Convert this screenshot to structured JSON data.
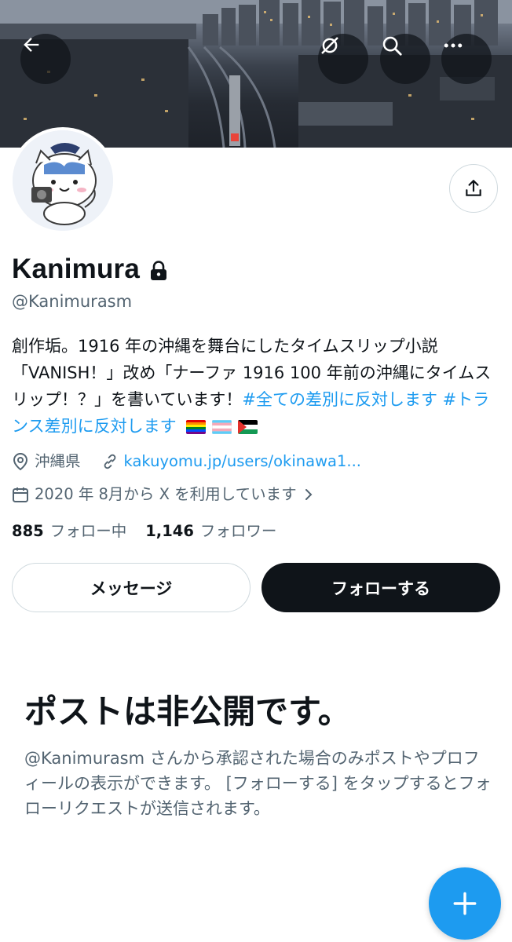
{
  "profile": {
    "display_name": "Kanimura",
    "handle": "@Kanimurasm",
    "bio_text": "創作垢。1916 年の沖縄を舞台にしたタイムスリップ小説「VANISH！」改め「ナーファ 1916 100 年前の沖縄にタイムスリップ！？」を書いています！",
    "bio_tag_1": "#全ての差別に反対します",
    "bio_tag_2": "#トランス差別に反対します",
    "location": "沖縄県",
    "website": "kakuyomu.jp/users/okinawa1...",
    "joined": "2020 年 8月から X を利用しています",
    "following_count": "885",
    "following_label": "フォロー中",
    "followers_count": "1,146",
    "followers_label": "フォロワー"
  },
  "actions": {
    "message_label": "メッセージ",
    "follow_label": "フォローする"
  },
  "private_notice": {
    "title": "ポストは非公開です。",
    "description": "@Kanimurasm さんから承認された場合のみポストやプロフィールの表示ができます。 [フォローする] をタップするとフォローリクエストが送信されます。"
  },
  "icons": {
    "back": "arrow-left-icon",
    "hide": "eye-slash-icon",
    "search": "search-icon",
    "more": "ellipsis-icon",
    "share": "share-icon",
    "lock": "lock-icon",
    "location": "location-pin-icon",
    "link": "link-icon",
    "calendar": "calendar-icon",
    "compose": "plus-icon"
  },
  "colors": {
    "accent": "#1d9bf0",
    "text_primary": "#0f1419",
    "text_secondary": "#536471",
    "border": "#cfd9de"
  }
}
